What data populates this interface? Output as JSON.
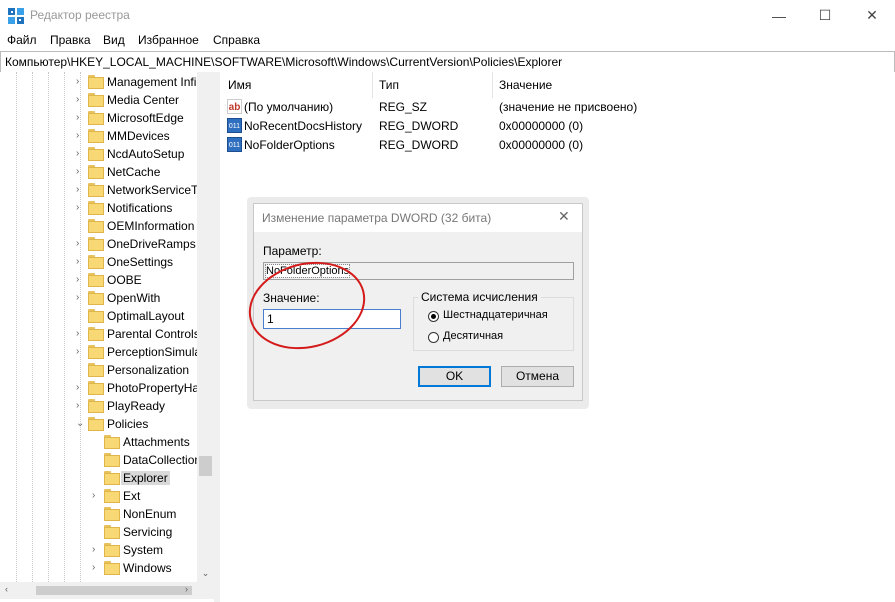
{
  "window": {
    "title": "Редактор реестра",
    "min_glyph": "—",
    "max_glyph": "☐",
    "close_glyph": "✕"
  },
  "menu": {
    "items": [
      "Файл",
      "Правка",
      "Вид",
      "Избранное",
      "Справка"
    ]
  },
  "address": {
    "path": "Компьютер\\HKEY_LOCAL_MACHINE\\SOFTWARE\\Microsoft\\Windows\\CurrentVersion\\Policies\\Explorer"
  },
  "tree": {
    "items": [
      {
        "label": "Management Infi",
        "expand": "›"
      },
      {
        "label": "Media Center",
        "expand": "›"
      },
      {
        "label": "MicrosoftEdge",
        "expand": "›"
      },
      {
        "label": "MMDevices",
        "expand": "›"
      },
      {
        "label": "NcdAutoSetup",
        "expand": "›"
      },
      {
        "label": "NetCache",
        "expand": "›"
      },
      {
        "label": "NetworkServiceTr",
        "expand": "›"
      },
      {
        "label": "Notifications",
        "expand": "›"
      },
      {
        "label": "OEMInformation",
        "expand": ""
      },
      {
        "label": "OneDriveRamps",
        "expand": "›"
      },
      {
        "label": "OneSettings",
        "expand": "›"
      },
      {
        "label": "OOBE",
        "expand": "›"
      },
      {
        "label": "OpenWith",
        "expand": "›"
      },
      {
        "label": "OptimalLayout",
        "expand": ""
      },
      {
        "label": "Parental Controls",
        "expand": "›"
      },
      {
        "label": "PerceptionSimula",
        "expand": "›"
      },
      {
        "label": "Personalization",
        "expand": ""
      },
      {
        "label": "PhotoPropertyHa",
        "expand": "›"
      },
      {
        "label": "PlayReady",
        "expand": "›"
      },
      {
        "label": "Policies",
        "expand": "⌄"
      },
      {
        "label": "Attachments",
        "expand": ""
      },
      {
        "label": "DataCollection",
        "expand": ""
      },
      {
        "label": "Explorer",
        "expand": ""
      },
      {
        "label": "Ext",
        "expand": "›"
      },
      {
        "label": "NonEnum",
        "expand": ""
      },
      {
        "label": "Servicing",
        "expand": ""
      },
      {
        "label": "System",
        "expand": "›"
      },
      {
        "label": "Windows",
        "expand": "›"
      }
    ],
    "selected_index": 22,
    "scroll_up_glyph": "⌃",
    "scroll_down_glyph": "⌄",
    "scroll_left_glyph": "‹",
    "scroll_right_glyph": "›"
  },
  "list": {
    "headers": {
      "name": "Имя",
      "type": "Тип",
      "data": "Значение"
    },
    "rows": [
      {
        "icon": "string-value-icon",
        "icon_text": "ab",
        "name": "(По умолчанию)",
        "type": "REG_SZ",
        "data": "(значение не присвоено)"
      },
      {
        "icon": "binary-value-icon",
        "icon_text": "011",
        "name": "NoRecentDocsHistory",
        "type": "REG_DWORD",
        "data": "0x00000000 (0)"
      },
      {
        "icon": "binary-value-icon",
        "icon_text": "011",
        "name": "NoFolderOptions",
        "type": "REG_DWORD",
        "data": "0x00000000 (0)"
      }
    ]
  },
  "dialog": {
    "title": "Изменение параметра DWORD (32 бита)",
    "close_glyph": "✕",
    "param_label": "Параметр:",
    "param_value": "NoFolderOptions",
    "value_label": "Значение:",
    "value_input": "1",
    "base_group_label": "Система исчисления",
    "radio_hex": "Шестнадцатеричная",
    "radio_dec": "Десятичная",
    "selected_base": "hex",
    "ok_label": "OK",
    "cancel_label": "Отмена"
  },
  "colors": {
    "highlight_circle": "#d41b1b",
    "folder": "#f8d775",
    "ok_border": "#0078d7"
  }
}
